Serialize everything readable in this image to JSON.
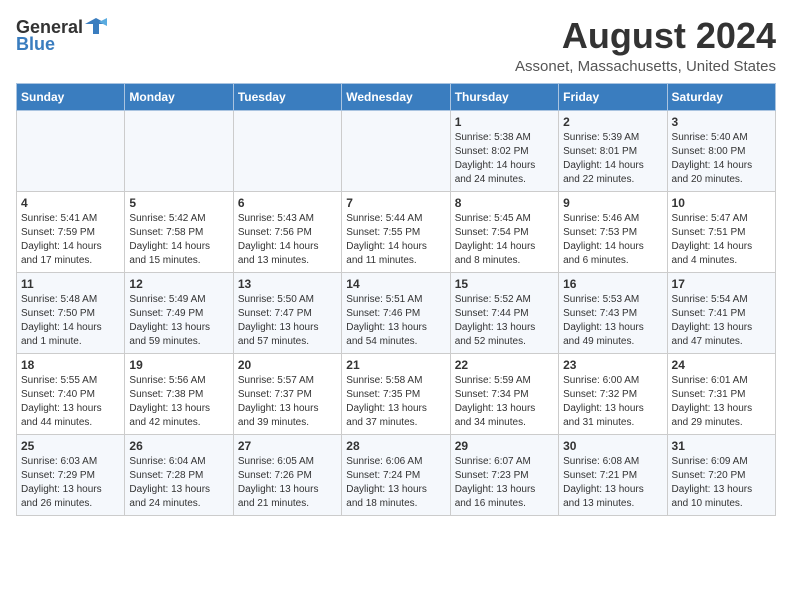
{
  "header": {
    "logo_general": "General",
    "logo_blue": "Blue",
    "month": "August 2024",
    "location": "Assonet, Massachusetts, United States"
  },
  "weekdays": [
    "Sunday",
    "Monday",
    "Tuesday",
    "Wednesday",
    "Thursday",
    "Friday",
    "Saturday"
  ],
  "weeks": [
    [
      {
        "day": "",
        "info": ""
      },
      {
        "day": "",
        "info": ""
      },
      {
        "day": "",
        "info": ""
      },
      {
        "day": "",
        "info": ""
      },
      {
        "day": "1",
        "info": "Sunrise: 5:38 AM\nSunset: 8:02 PM\nDaylight: 14 hours\nand 24 minutes."
      },
      {
        "day": "2",
        "info": "Sunrise: 5:39 AM\nSunset: 8:01 PM\nDaylight: 14 hours\nand 22 minutes."
      },
      {
        "day": "3",
        "info": "Sunrise: 5:40 AM\nSunset: 8:00 PM\nDaylight: 14 hours\nand 20 minutes."
      }
    ],
    [
      {
        "day": "4",
        "info": "Sunrise: 5:41 AM\nSunset: 7:59 PM\nDaylight: 14 hours\nand 17 minutes."
      },
      {
        "day": "5",
        "info": "Sunrise: 5:42 AM\nSunset: 7:58 PM\nDaylight: 14 hours\nand 15 minutes."
      },
      {
        "day": "6",
        "info": "Sunrise: 5:43 AM\nSunset: 7:56 PM\nDaylight: 14 hours\nand 13 minutes."
      },
      {
        "day": "7",
        "info": "Sunrise: 5:44 AM\nSunset: 7:55 PM\nDaylight: 14 hours\nand 11 minutes."
      },
      {
        "day": "8",
        "info": "Sunrise: 5:45 AM\nSunset: 7:54 PM\nDaylight: 14 hours\nand 8 minutes."
      },
      {
        "day": "9",
        "info": "Sunrise: 5:46 AM\nSunset: 7:53 PM\nDaylight: 14 hours\nand 6 minutes."
      },
      {
        "day": "10",
        "info": "Sunrise: 5:47 AM\nSunset: 7:51 PM\nDaylight: 14 hours\nand 4 minutes."
      }
    ],
    [
      {
        "day": "11",
        "info": "Sunrise: 5:48 AM\nSunset: 7:50 PM\nDaylight: 14 hours\nand 1 minute."
      },
      {
        "day": "12",
        "info": "Sunrise: 5:49 AM\nSunset: 7:49 PM\nDaylight: 13 hours\nand 59 minutes."
      },
      {
        "day": "13",
        "info": "Sunrise: 5:50 AM\nSunset: 7:47 PM\nDaylight: 13 hours\nand 57 minutes."
      },
      {
        "day": "14",
        "info": "Sunrise: 5:51 AM\nSunset: 7:46 PM\nDaylight: 13 hours\nand 54 minutes."
      },
      {
        "day": "15",
        "info": "Sunrise: 5:52 AM\nSunset: 7:44 PM\nDaylight: 13 hours\nand 52 minutes."
      },
      {
        "day": "16",
        "info": "Sunrise: 5:53 AM\nSunset: 7:43 PM\nDaylight: 13 hours\nand 49 minutes."
      },
      {
        "day": "17",
        "info": "Sunrise: 5:54 AM\nSunset: 7:41 PM\nDaylight: 13 hours\nand 47 minutes."
      }
    ],
    [
      {
        "day": "18",
        "info": "Sunrise: 5:55 AM\nSunset: 7:40 PM\nDaylight: 13 hours\nand 44 minutes."
      },
      {
        "day": "19",
        "info": "Sunrise: 5:56 AM\nSunset: 7:38 PM\nDaylight: 13 hours\nand 42 minutes."
      },
      {
        "day": "20",
        "info": "Sunrise: 5:57 AM\nSunset: 7:37 PM\nDaylight: 13 hours\nand 39 minutes."
      },
      {
        "day": "21",
        "info": "Sunrise: 5:58 AM\nSunset: 7:35 PM\nDaylight: 13 hours\nand 37 minutes."
      },
      {
        "day": "22",
        "info": "Sunrise: 5:59 AM\nSunset: 7:34 PM\nDaylight: 13 hours\nand 34 minutes."
      },
      {
        "day": "23",
        "info": "Sunrise: 6:00 AM\nSunset: 7:32 PM\nDaylight: 13 hours\nand 31 minutes."
      },
      {
        "day": "24",
        "info": "Sunrise: 6:01 AM\nSunset: 7:31 PM\nDaylight: 13 hours\nand 29 minutes."
      }
    ],
    [
      {
        "day": "25",
        "info": "Sunrise: 6:03 AM\nSunset: 7:29 PM\nDaylight: 13 hours\nand 26 minutes."
      },
      {
        "day": "26",
        "info": "Sunrise: 6:04 AM\nSunset: 7:28 PM\nDaylight: 13 hours\nand 24 minutes."
      },
      {
        "day": "27",
        "info": "Sunrise: 6:05 AM\nSunset: 7:26 PM\nDaylight: 13 hours\nand 21 minutes."
      },
      {
        "day": "28",
        "info": "Sunrise: 6:06 AM\nSunset: 7:24 PM\nDaylight: 13 hours\nand 18 minutes."
      },
      {
        "day": "29",
        "info": "Sunrise: 6:07 AM\nSunset: 7:23 PM\nDaylight: 13 hours\nand 16 minutes."
      },
      {
        "day": "30",
        "info": "Sunrise: 6:08 AM\nSunset: 7:21 PM\nDaylight: 13 hours\nand 13 minutes."
      },
      {
        "day": "31",
        "info": "Sunrise: 6:09 AM\nSunset: 7:20 PM\nDaylight: 13 hours\nand 10 minutes."
      }
    ]
  ]
}
